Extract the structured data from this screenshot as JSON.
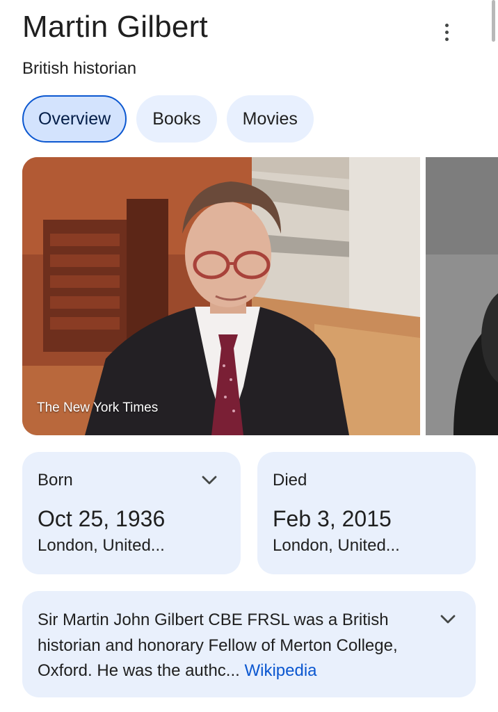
{
  "header": {
    "title": "Martin Gilbert",
    "subtitle": "British historian",
    "menu_icon": "more-vert-icon"
  },
  "tabs": [
    {
      "label": "Overview",
      "active": true
    },
    {
      "label": "Books",
      "active": false
    },
    {
      "label": "Movies",
      "active": false
    }
  ],
  "images": {
    "main_credit": "The New York Times"
  },
  "facts": {
    "born": {
      "label": "Born",
      "date": "Oct 25, 1936",
      "place": "London, United..."
    },
    "died": {
      "label": "Died",
      "date": "Feb 3, 2015",
      "place": "London, United..."
    }
  },
  "description": {
    "text": "Sir Martin John Gilbert CBE FRSL was a British historian and honorary Fellow of Merton College, Oxford. He was the authc...",
    "source_link": "Wikipedia"
  },
  "colors": {
    "accent": "#0b57d0",
    "chip_bg": "#e8f0fe",
    "card_bg": "#e9f0fc"
  }
}
